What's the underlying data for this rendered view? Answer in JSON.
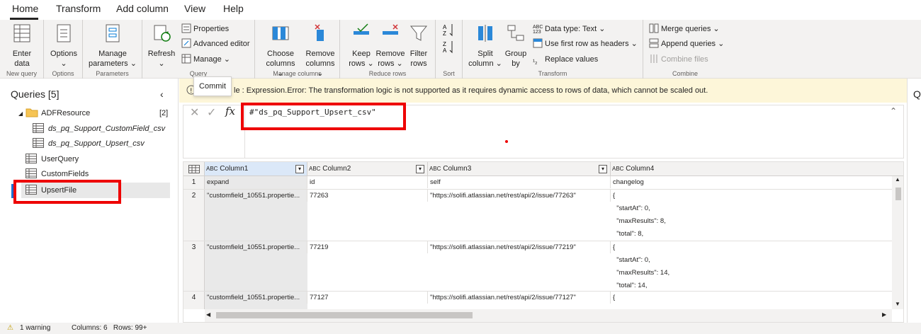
{
  "tabs": [
    "Home",
    "Transform",
    "Add column",
    "View",
    "Help"
  ],
  "ribbon": {
    "new_query": {
      "enter_data": [
        "Enter",
        "data"
      ],
      "group_label": "New query"
    },
    "options": {
      "label": [
        "Options",
        "⌄"
      ],
      "group_label": "Options"
    },
    "parameters": {
      "label": [
        "Manage",
        "parameters ⌄"
      ],
      "group_label": "Parameters"
    },
    "query": {
      "refresh": [
        "Refresh",
        "⌄"
      ],
      "properties": "Properties",
      "advanced_editor": "Advanced editor",
      "manage": "Manage ⌄",
      "group_label": "Query"
    },
    "manage_columns": {
      "choose": [
        "Choose",
        "columns ⌄"
      ],
      "remove": [
        "Remove",
        "columns ⌄"
      ],
      "group_label": "Manage columns"
    },
    "reduce_rows": {
      "keep": [
        "Keep",
        "rows ⌄"
      ],
      "remove": [
        "Remove",
        "rows ⌄"
      ],
      "filter": [
        "Filter",
        "rows"
      ],
      "group_label": "Reduce rows"
    },
    "sort": {
      "group_label": "Sort"
    },
    "transform": {
      "split": [
        "Split",
        "column ⌄"
      ],
      "group": [
        "Group",
        "by"
      ],
      "data_type": "Data type: Text ⌄",
      "first_row": "Use first row as headers ⌄",
      "replace": "Replace values",
      "group_label": "Transform"
    },
    "combine": {
      "merge": "Merge queries ⌄",
      "append": "Append queries ⌄",
      "combine_files": "Combine files",
      "group_label": "Combine"
    }
  },
  "queries": {
    "title": "Queries [5]",
    "folder": {
      "name": "ADFResource",
      "count": "[2]"
    },
    "items": [
      "ds_pq_Support_CustomField_csv",
      "ds_pq_Support_Upsert_csv",
      "UserQuery",
      "CustomFields",
      "UpsertFile"
    ]
  },
  "warning": {
    "tooltip": "Commit",
    "text": "le : Expression.Error: The transformation logic is not supported as it requires dynamic access to rows of data, which cannot be scaled out."
  },
  "formula": {
    "fx": "fx",
    "text": "#\"ds_pq_Support_Upsert_csv\""
  },
  "grid": {
    "columns": [
      "Column1",
      "Column2",
      "Column3",
      "Column4"
    ],
    "rows": [
      {
        "n": "1",
        "c1": "expand",
        "c2": "id",
        "c3": "self",
        "c4": [
          "changelog"
        ]
      },
      {
        "n": "2",
        "c1": "\"customfield_10551.propertie...",
        "c2": "77263",
        "c3": "\"https://solifi.atlassian.net/rest/api/2/issue/77263\"",
        "c4": [
          "{",
          "  \"startAt\": 0,",
          "  \"maxResults\": 8,",
          "  \"total\": 8,"
        ]
      },
      {
        "n": "3",
        "c1": "\"customfield_10551.propertie...",
        "c2": "77219",
        "c3": "\"https://solifi.atlassian.net/rest/api/2/issue/77219\"",
        "c4": [
          "{",
          "  \"startAt\": 0,",
          "  \"maxResults\": 14,",
          "  \"total\": 14,"
        ]
      },
      {
        "n": "4",
        "c1": "\"customfield_10551.propertie...",
        "c2": "77127",
        "c3": "\"https://solifi.atlassian.net/rest/api/2/issue/77127\"",
        "c4": [
          "{"
        ]
      }
    ]
  },
  "status": {
    "warnings": "1 warning",
    "info": "Columns: 6   Rows: 99+"
  }
}
